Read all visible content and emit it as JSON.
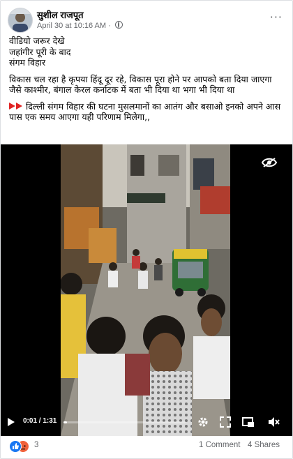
{
  "post": {
    "author": "सुशील राजपूत",
    "date": "April 30 at 10:16 AM",
    "separator": "·",
    "more_label": "···",
    "lines": [
      "वीडियो जरूर देखे",
      "जहांगीर पूरी के बाद",
      "संगम विहार",
      "विकास चल रहा है कृपया हिंदू दूर रहे, विकास पूरा होने पर आपको बता दिया जाएगा",
      "जैसे काश्मीर, बंगाल केरल  कर्नाटक  में बता भी दिया था भगा भी दिया था",
      "दिल्ली संगम विहार की घटना मुसलमानों का आतंग और बसाओ इनको अपने आस पास एक समय आएगा यही परिणाम मिलेगा,,"
    ]
  },
  "video": {
    "time": "0:01 / 1:31",
    "progress": 0.01,
    "icons": [
      "play-icon",
      "settings-icon",
      "fullscreen-icon",
      "pip-icon",
      "volume-icon",
      "eye-icon"
    ]
  },
  "footer": {
    "reaction_count": "3",
    "comments": "1 Comment",
    "shares": "4 Shares"
  },
  "colors": {
    "like": "#1877f2",
    "angry": "#f0613a",
    "meta": "#65676b"
  }
}
